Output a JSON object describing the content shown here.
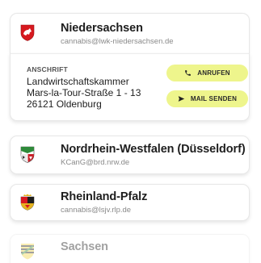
{
  "states": [
    {
      "name": "Niedersachsen",
      "email": "cannabis@lwk-niedersachsen.de",
      "expanded": true,
      "address_label": "ANSCHRIFT",
      "address_lines": [
        "Landwirtschaftskammer",
        "Mars-la-Tour-Straße 1 - 13",
        "26121 Oldenburg"
      ],
      "call_label": "ANRUFEN",
      "mail_label": "MAIL SENDEN"
    },
    {
      "name": "Nordrhein-Westfalen (Düsseldorf)",
      "email": "KCanG@brd.nrw.de"
    },
    {
      "name": "Rheinland-Pfalz",
      "email": "cannabis@lsjv.rlp.de"
    },
    {
      "name": "Sachsen",
      "email": ""
    }
  ],
  "colors": {
    "accent": "#eef58c",
    "crest_red": "#d7191f"
  }
}
